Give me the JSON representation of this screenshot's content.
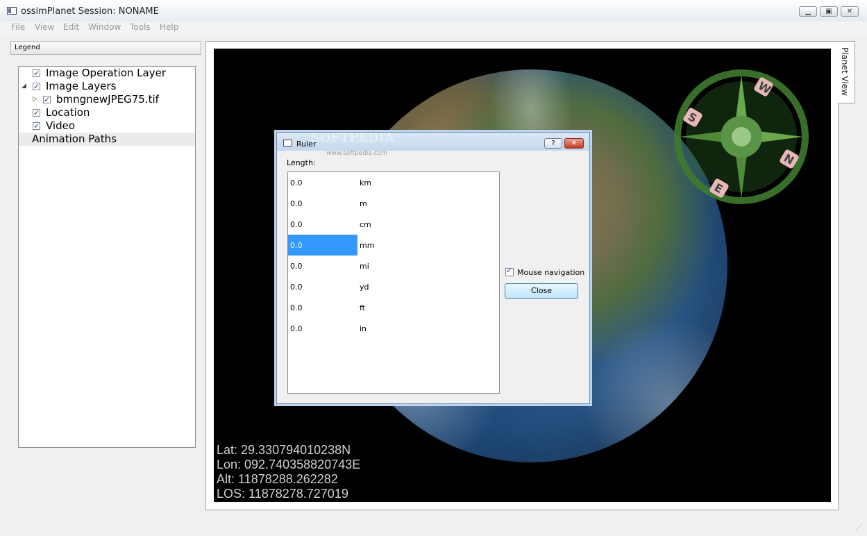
{
  "window": {
    "title": "ossimPlanet Session: NONAME"
  },
  "menu": [
    "File",
    "View",
    "Edit",
    "Window",
    "Tools",
    "Help"
  ],
  "legend": {
    "header": "Legend",
    "items": [
      {
        "label": "Image Operation Layer",
        "checked": true
      },
      {
        "label": "Image Layers",
        "checked": true,
        "expanded": true
      },
      {
        "label": "bmngnewJPEG75.tif",
        "checked": true,
        "expanded": false
      },
      {
        "label": "Location",
        "checked": true
      },
      {
        "label": "Video",
        "checked": true
      },
      {
        "label": "Animation Paths"
      }
    ]
  },
  "planet_tab": "Planet View",
  "coords": {
    "lat": "Lat: 29.330794010238N",
    "lon": "Lon: 092.740358820743E",
    "alt": "Alt: 11878288.262282",
    "los": "LOS: 11878278.727019"
  },
  "compass": {
    "letters": [
      "N",
      "E",
      "S",
      "W"
    ],
    "colors": {
      "ring": "#3e7a2e",
      "letter_bg": "#e8b8b8"
    }
  },
  "ruler": {
    "title": "Ruler",
    "help_label": "?",
    "close_x": "✕",
    "length_label": "Length:",
    "units": [
      {
        "value": "0.0",
        "unit": "km"
      },
      {
        "value": "0.0",
        "unit": "m"
      },
      {
        "value": "0.0",
        "unit": "cm"
      },
      {
        "value": "0.0",
        "unit": "mm",
        "selected": true
      },
      {
        "value": "0.0",
        "unit": "mi"
      },
      {
        "value": "0.0",
        "unit": "yd"
      },
      {
        "value": "0.0",
        "unit": "ft"
      },
      {
        "value": "0.0",
        "unit": "in"
      }
    ],
    "mouse_navigation": "Mouse navigation",
    "close": "Close"
  },
  "watermark": {
    "main": "SOFTPEDIA",
    "sub": "www.softpedia.com"
  }
}
